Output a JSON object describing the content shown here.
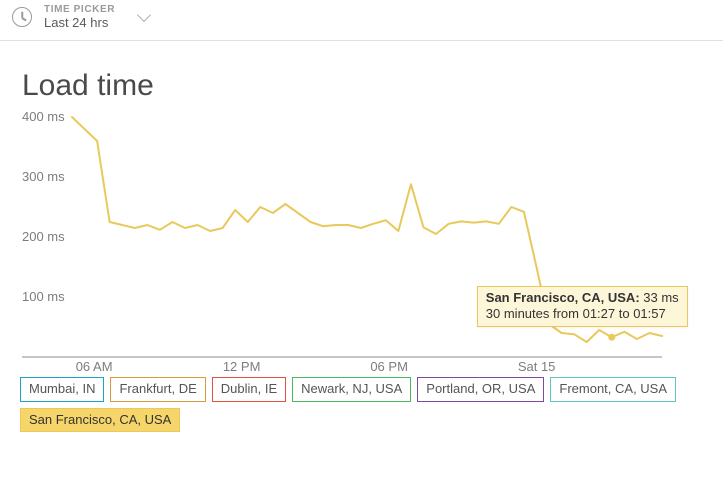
{
  "header": {
    "picker_label": "TIME PICKER",
    "picker_value": "Last 24 hrs"
  },
  "title": "Load time",
  "tooltip": {
    "series_name": "San Francisco, CA, USA:",
    "value": "33 ms",
    "subtext": "30 minutes from 01:27 to 01:57"
  },
  "legend": [
    {
      "label": "Mumbai, IN",
      "color": "#1ba4c7",
      "active": false
    },
    {
      "label": "Frankfurt, DE",
      "color": "#d89a3a",
      "active": false
    },
    {
      "label": "Dublin, IE",
      "color": "#e0523e",
      "active": false
    },
    {
      "label": "Newark, NJ, USA",
      "color": "#49b95e",
      "active": false
    },
    {
      "label": "Portland, OR, USA",
      "color": "#7d4a9e",
      "active": false
    },
    {
      "label": "Fremont, CA, USA",
      "color": "#5bc6c2",
      "active": false
    },
    {
      "label": "San Francisco, CA, USA",
      "color": "#e9c85c",
      "active": true
    }
  ],
  "chart_data": {
    "type": "line",
    "title": "Load time",
    "xlabel": "",
    "ylabel": "",
    "ylim": [
      0,
      400
    ],
    "y_unit": "ms",
    "y_ticks": [
      100,
      200,
      300,
      400
    ],
    "x_ticks": [
      "06 AM",
      "12 PM",
      "06 PM",
      "Sat 15"
    ],
    "x": [
      0,
      1,
      2,
      3,
      4,
      5,
      6,
      7,
      8,
      9,
      10,
      11,
      12,
      13,
      14,
      15,
      16,
      17,
      18,
      19,
      20,
      21,
      22,
      23,
      24,
      25,
      26,
      27,
      28,
      29,
      30,
      31,
      32,
      33,
      34,
      35,
      36,
      37,
      38,
      39,
      40,
      41,
      42,
      43,
      44,
      45,
      46,
      47
    ],
    "series": [
      {
        "name": "San Francisco, CA, USA",
        "color": "#e9c85c",
        "values": [
          400,
          380,
          360,
          225,
          220,
          215,
          220,
          212,
          225,
          215,
          220,
          210,
          215,
          245,
          225,
          250,
          240,
          255,
          240,
          225,
          218,
          220,
          220,
          215,
          222,
          228,
          210,
          288,
          216,
          205,
          222,
          226,
          224,
          226,
          222,
          250,
          242,
          150,
          55,
          40,
          38,
          25,
          45,
          33,
          42,
          30,
          40,
          35
        ]
      }
    ],
    "highlight_point": {
      "index": 43,
      "value": 33
    },
    "range_hours": 24
  }
}
